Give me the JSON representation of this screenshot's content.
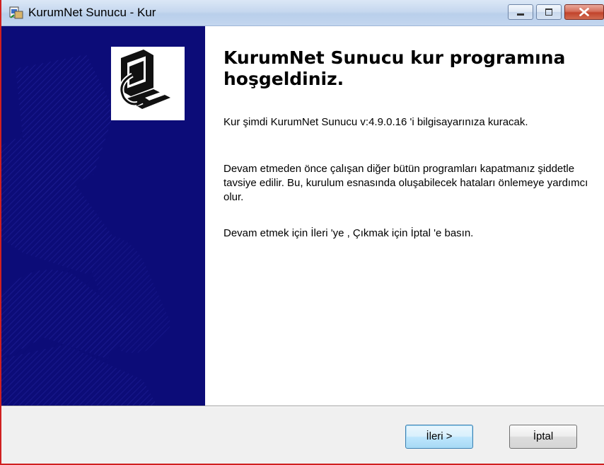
{
  "window": {
    "title": "KurumNet Sunucu - Kur"
  },
  "welcome": {
    "title": "KurumNet Sunucu kur programına hoşgeldiniz.",
    "paragraph1": "Kur şimdi KurumNet Sunucu v:4.9.0.16  'i bilgisayarınıza kuracak.",
    "paragraph2": "Devam etmeden önce çalışan diğer bütün programları kapatmanız şiddetle tavsiye edilir. Bu, kurulum esnasında oluşabilecek hataları önlemeye yardımcı olur.",
    "paragraph3": "Devam etmek için İleri 'ye , Çıkmak için İptal  'e basın."
  },
  "buttons": {
    "next": "İleri >",
    "cancel": "İptal"
  },
  "icons": {
    "app": "installer-app-icon",
    "logo": "computer-install-icon",
    "minimize": "minimize-icon",
    "maximize": "maximize-icon",
    "close": "close-icon"
  },
  "colors": {
    "left_panel": "#0c0c78",
    "close_button": "#c2442c",
    "default_button_border": "#3c7fb1"
  }
}
